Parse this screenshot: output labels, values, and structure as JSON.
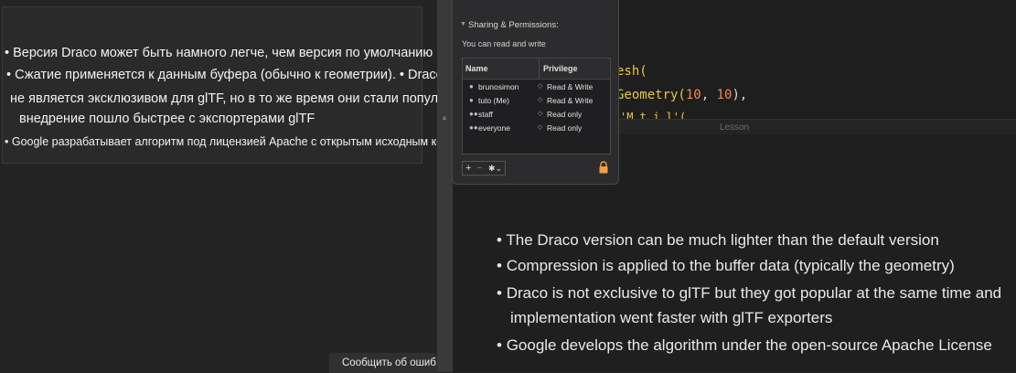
{
  "translation": {
    "lines": [
      "• Версия Draco может быть намного легче, чем версия по умолчанию",
      "• Сжатие применяется к данным буфера (обычно к геометрии). • Draco",
      "не является эксклюзивом для glTF, но в то же время они стали популярными, и",
      "внедрение пошло быстрее с экспортерами glTF",
      "• Google разрабатывает алгоритм под лицензией Apache с открытым исходным кодом."
    ]
  },
  "report_error": "Сообщить об ошиб",
  "info_panel": {
    "section_title": "Sharing & Permissions:",
    "permission_note": "You can read and write",
    "columns": {
      "name": "Name",
      "privilege": "Privilege"
    },
    "rows": [
      {
        "name": "brunosimon",
        "privilege": "Read & Write",
        "icon": "user-icon"
      },
      {
        "name": "tuto (Me)",
        "privilege": "Read & Write",
        "icon": "user-icon"
      },
      {
        "name": "staff",
        "privilege": "Read only",
        "icon": "group-icon"
      },
      {
        "name": "everyone",
        "privilege": "Read only",
        "icon": "group-icon"
      }
    ],
    "toolbar": {
      "add": "+",
      "remove": "−",
      "action": "✱⌄"
    }
  },
  "code": {
    "line1": {
      "a": "esh(",
      "color": "#e8c547"
    },
    "line2": {
      "a": "Geometry(",
      "b": "10",
      "c": ", ",
      "d": "10",
      "e": "),",
      "color_fn": "#e8c547",
      "color_num": "#f08a4b"
    },
    "line3": {
      "a": "'M t    i l'(",
      "color": "#e8c547"
    }
  },
  "lesson_label": "Lesson",
  "slide": {
    "bullets": [
      "The Draco version can be much lighter than the default version",
      "Compression is applied to the buffer data (typically the geometry)",
      "Draco is not exclusive to glTF but they got popular at the same time and",
      "implementation went faster with glTF exporters",
      "Google develops the algorithm under the open-source Apache License"
    ]
  },
  "colors": {
    "lock": "#f0a03a",
    "background": "#232323"
  }
}
